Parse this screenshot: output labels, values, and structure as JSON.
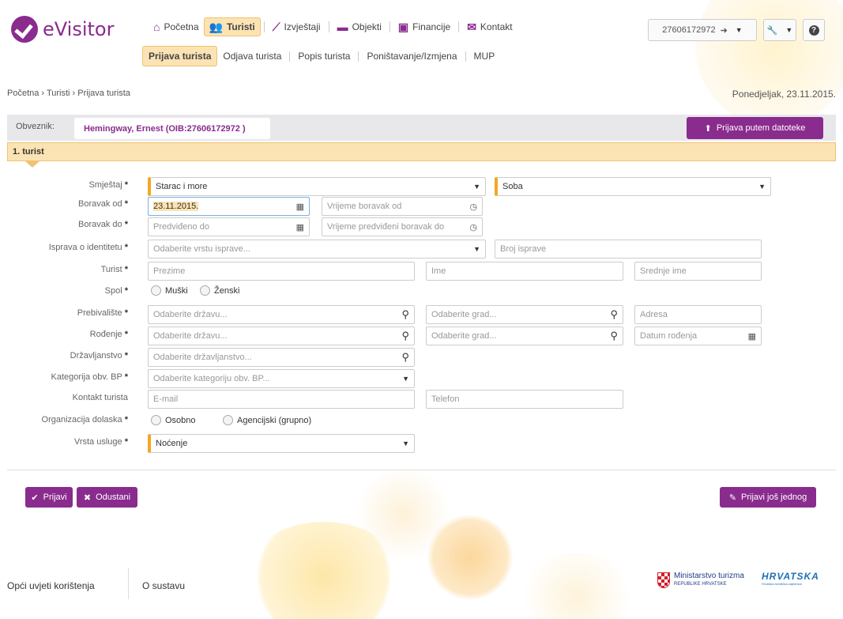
{
  "header": {
    "logo_text": "eVisitor",
    "nav": [
      {
        "label": "Početna",
        "icon": "home-icon",
        "active": false
      },
      {
        "label": "Turisti",
        "icon": "users-icon",
        "active": true
      },
      {
        "label": "Izvještaji",
        "icon": "chart-icon",
        "active": false
      },
      {
        "label": "Objekti",
        "icon": "bed-icon",
        "active": false
      },
      {
        "label": "Financije",
        "icon": "money-icon",
        "active": false
      },
      {
        "label": "Kontakt",
        "icon": "envelope-icon",
        "active": false
      }
    ],
    "subnav": [
      {
        "label": "Prijava turista",
        "active": true
      },
      {
        "label": "Odjava turista",
        "active": false
      },
      {
        "label": "Popis turista",
        "active": false
      },
      {
        "label": "Poništavanje/Izmjena",
        "active": false
      },
      {
        "label": "MUP",
        "active": false
      }
    ],
    "user_id": "27606172972",
    "accent": "#8a2b8e",
    "highlight": "#fce3b3"
  },
  "breadcrumb": [
    "Početna",
    "Turisti",
    "Prijava turista"
  ],
  "date": "Ponedjeljak, 23.11.2015.",
  "obveznik": {
    "label": "Obveznik:",
    "value": "Hemingway, Ernest (OIB:27606172972 )",
    "upload_button": "Prijava putem datoteke"
  },
  "section_title": "1. turist",
  "form": {
    "smjestaj": {
      "label": "Smještaj",
      "value": "Starac i more",
      "unit": "Soba"
    },
    "boravak_od": {
      "label": "Boravak od",
      "value": "23.11.2015.",
      "time_placeholder": "Vrijeme boravak od"
    },
    "boravak_do": {
      "label": "Boravak do",
      "placeholder": "Predviđeno do",
      "time_placeholder": "Vrijeme predviđeni boravak do"
    },
    "isprava": {
      "label": "Isprava o identitetu",
      "placeholder": "Odaberite vrstu isprave...",
      "number_placeholder": "Broj isprave"
    },
    "turist": {
      "label": "Turist",
      "surname": "Prezime",
      "name": "Ime",
      "middle": "Srednje ime"
    },
    "spol": {
      "label": "Spol",
      "options": [
        "Muški",
        "Ženski"
      ]
    },
    "prebivaliste": {
      "label": "Prebivalište",
      "country": "Odaberite državu...",
      "city": "Odaberite grad...",
      "address": "Adresa"
    },
    "rodenje": {
      "label": "Rođenje",
      "country": "Odaberite državu...",
      "city": "Odaberite grad...",
      "date": "Datum rođenja"
    },
    "drzavljanstvo": {
      "label": "Državljanstvo",
      "placeholder": "Odaberite državljanstvo..."
    },
    "kategorija": {
      "label": "Kategorija obv. BP",
      "placeholder": "Odaberite kategoriju obv. BP..."
    },
    "kontakt": {
      "label": "Kontakt turista",
      "email": "E-mail",
      "phone": "Telefon"
    },
    "organizacija": {
      "label": "Organizacija dolaska",
      "options": [
        "Osobno",
        "Agencijski (grupno)"
      ]
    },
    "usluga": {
      "label": "Vrsta usluge",
      "value": "Noćenje"
    }
  },
  "actions": {
    "submit": "Prijavi",
    "cancel": "Odustani",
    "again": "Prijavi još jednog"
  },
  "footer": {
    "terms": "Opći uvjeti korištenja",
    "about": "O sustavu",
    "ministry": "Ministarstvo turizma",
    "ministry_sub": "REPUBLIKE HRVATSKE",
    "brand": "HRVATSKA",
    "brand_sub": "Hrvatska turistička zajednica"
  }
}
